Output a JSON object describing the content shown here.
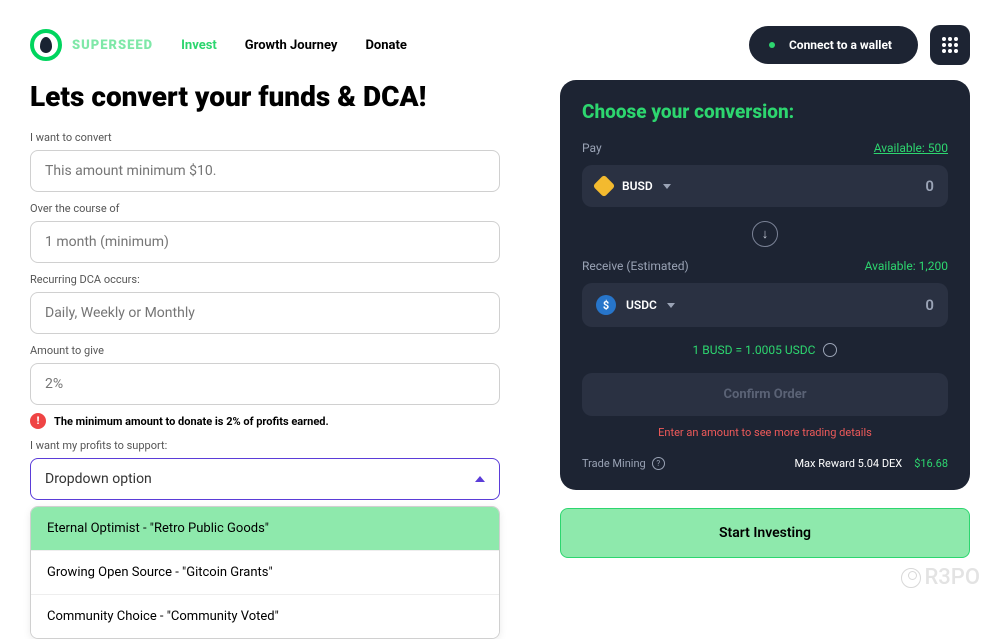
{
  "brand": "SUPERSEED",
  "nav": {
    "invest": "Invest",
    "growth": "Growth Journey",
    "donate": "Donate"
  },
  "header": {
    "connect": "Connect to a wallet"
  },
  "form": {
    "title": "Lets convert your funds & DCA!",
    "l_convert": "I want to convert",
    "ph_convert": "This amount minimum $10.",
    "l_course": "Over the course of",
    "ph_course": "1 month (minimum)",
    "l_recur": "Recurring DCA occurs:",
    "ph_recur": "Daily, Weekly or Monthly",
    "l_amount": "Amount to give",
    "ph_amount": "2%",
    "warning": "The minimum amount to donate is 2% of profits earned.",
    "l_support": "I want my profits to support:",
    "dd_selected": "Dropdown option",
    "opts": {
      "a": "Eternal Optimist - \"Retro Public Goods\"",
      "b": "Growing Open Source - \"Gitcoin Grants\"",
      "c": "Community Choice - \"Community Voted\""
    }
  },
  "panel": {
    "title": "Choose your conversion:",
    "pay": "Pay",
    "avail_pay": "Available: 500",
    "token1": "BUSD",
    "amt1": "0",
    "receive": "Receive (Estimated)",
    "avail_rec": "Available: 1,200",
    "token2": "USDC",
    "amt2": "0",
    "rate": "1 BUSD = 1.0005 USDC",
    "confirm": "Confirm Order",
    "hint": "Enter an amount to see more trading details",
    "tm_label": "Trade Mining",
    "tm_reward": "Max Reward 5.04 DEX",
    "tm_val": "$16.68"
  },
  "start": "Start Investing",
  "watermark": "R3PO"
}
